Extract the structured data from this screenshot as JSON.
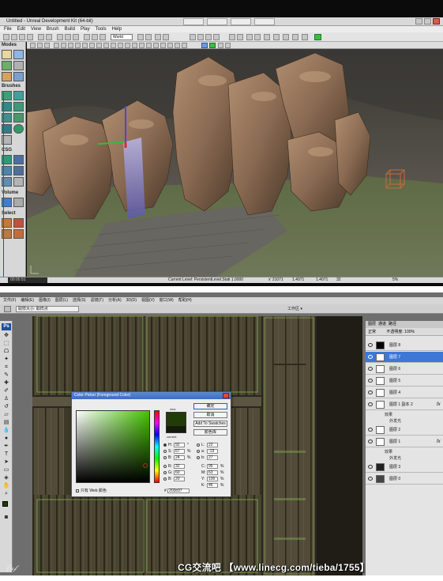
{
  "unreal": {
    "title": "Untitled - Unreal Development Kit (64-bit)",
    "tabs": [
      "",
      "",
      "",
      ""
    ],
    "menu": [
      "File",
      "Edit",
      "View",
      "Brush",
      "Build",
      "Play",
      "Tools",
      "Help"
    ],
    "coordinate_system": "World",
    "modes": {
      "header": "Modes",
      "brushes": "Brushes",
      "csg": "CSG",
      "volume": "Volume",
      "select": "Select"
    },
    "status": {
      "current_level": "Current Level:  PersistentLevel.Stati 1.0000",
      "x_value": "x' 21071",
      "y_value": "1.4071",
      "z_value": "1.4071",
      "grid": "32",
      "drag_grid": "5%",
      "level_chip": "00:00  51"
    }
  },
  "photoshop": {
    "menu": [
      "文件(F)",
      "编辑(E)",
      "图像(I)",
      "图层(L)",
      "选择(S)",
      "滤镜(T)",
      "分析(A)",
      "3D(D)",
      "视图(V)",
      "窗口(W)",
      "帮助(H)"
    ],
    "options_dropdown": "取样大小: 取样点",
    "workspace": "工作区 ▾",
    "layers_panel": {
      "tabs": [
        "图层",
        "通道",
        "路径"
      ],
      "mode": "正常",
      "opacity_label": "不透明度: 100%",
      "layers": [
        {
          "name": "图层 8",
          "selected": false,
          "fx": false
        },
        {
          "name": "图层 7",
          "selected": true,
          "fx": false
        },
        {
          "name": "图层 6",
          "selected": false,
          "fx": false
        },
        {
          "name": "图层 5",
          "selected": false,
          "fx": false
        },
        {
          "name": "图层 4",
          "selected": false,
          "fx": false
        },
        {
          "name": "图层 1 副本 2",
          "selected": false,
          "fx": true
        },
        {
          "name": "图层 2",
          "selected": false,
          "fx": false
        },
        {
          "name": "图层 1",
          "selected": false,
          "fx": true
        },
        {
          "name": "图层 3",
          "selected": false,
          "fx": false
        },
        {
          "name": "图层 0",
          "selected": false,
          "fx": false
        }
      ],
      "effects_label": "效果",
      "effect_name": "外发光"
    },
    "color_picker": {
      "title": "Color Picker (Foreground Color)",
      "new_label": "new",
      "current_label": "current",
      "buttons": {
        "ok": "确定",
        "cancel": "取消",
        "add_swatches": "Add To Swatches",
        "libraries": "颜色库"
      },
      "fields": {
        "H": "92",
        "S": "67",
        "B": "24",
        "R": "32",
        "G": "60",
        "B2": "20",
        "L": "22",
        "a": "-19",
        "b": "27",
        "C": "95",
        "M": "63",
        "Y": "100",
        "K": "46"
      },
      "units": {
        "deg": "°",
        "pct": "%"
      },
      "web_only": "只有 Web 颜色",
      "hex": "203c07",
      "new_color": "#203c07",
      "current_color": "#121c06"
    }
  },
  "watermark": "CG交流吧  【www.linecg.com/tieba/1755】",
  "watermark_left": "ꞵ𝓈𝒻"
}
